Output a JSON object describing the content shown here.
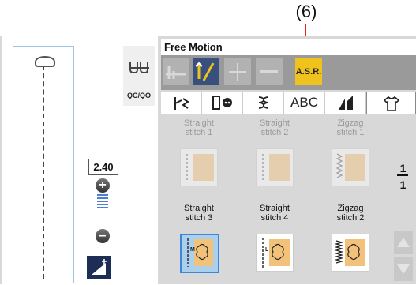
{
  "callout": {
    "label": "(6)"
  },
  "colors": {
    "accent_selected": "#3f86d8",
    "asr_button": "#f0c21e",
    "callout_line": "#e8241f",
    "toolbar": "#9a9a9a"
  },
  "left_panel": {
    "qc_qo_label": "QC/QO",
    "length_value": "2.40",
    "plus_label": "+",
    "minus_label": "–"
  },
  "header": {
    "title": "Free Motion"
  },
  "toolbar": {
    "tools": [
      "needle-plate-icon",
      "needle-up-down-icon",
      "cross-icon",
      "dash-icon"
    ],
    "asr_label": "A.S.R."
  },
  "tabs": [
    {
      "icon": "utility-stitch-icon",
      "label": ""
    },
    {
      "icon": "buttonhole-icon",
      "label": ""
    },
    {
      "icon": "decorative-stitch-icon",
      "label": ""
    },
    {
      "icon": "",
      "label": "ABC"
    },
    {
      "icon": "quilt-icon",
      "label": ""
    },
    {
      "icon": "shirt-icon",
      "label": "",
      "active": true
    }
  ],
  "stitches": [
    {
      "line1": "Straight",
      "line2": "stitch 1",
      "enabled": false,
      "selected": false
    },
    {
      "line1": "Straight",
      "line2": "stitch 2",
      "enabled": false,
      "selected": false
    },
    {
      "line1": "Zigzag",
      "line2": "stitch 1",
      "enabled": false,
      "selected": false
    },
    {
      "line1": "Straight",
      "line2": "stitch 3",
      "enabled": true,
      "selected": true
    },
    {
      "line1": "Straight",
      "line2": "stitch 4",
      "enabled": true,
      "selected": false
    },
    {
      "line1": "Zigzag",
      "line2": "stitch 2",
      "enabled": true,
      "selected": false
    }
  ],
  "pager": {
    "current": "1",
    "total": "1"
  }
}
